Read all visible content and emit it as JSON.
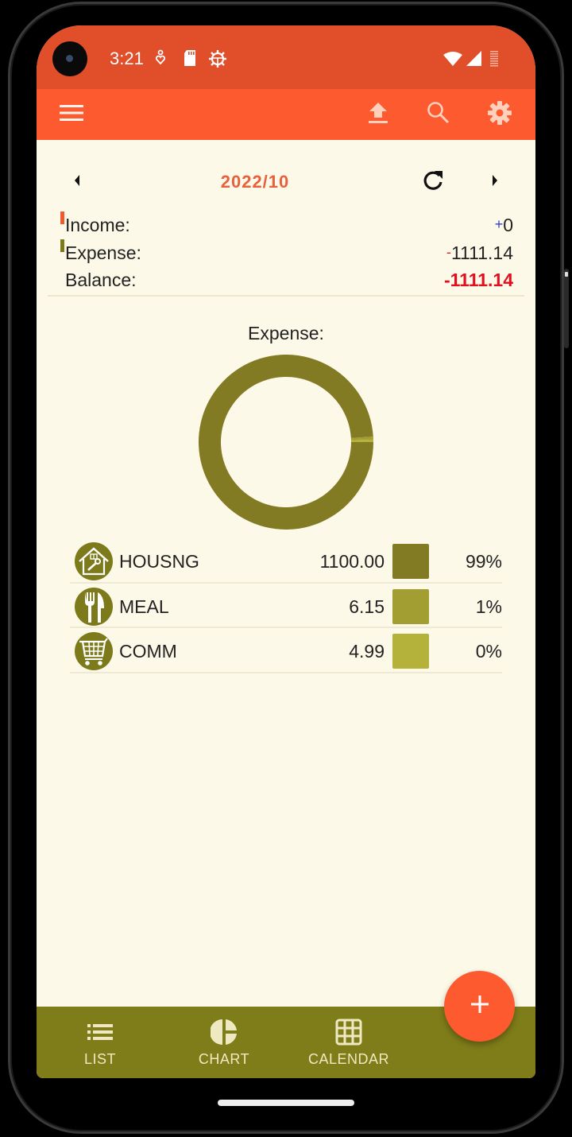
{
  "status_bar": {
    "time": "3:21",
    "left_icons": [
      "location-heart-icon",
      "sd-card-icon",
      "debug-bug-icon"
    ],
    "right_icons": [
      "wifi-icon",
      "cell-signal-icon",
      "battery-icon"
    ]
  },
  "toolbar": {
    "menu_icon": "hamburger-menu-icon",
    "actions": [
      "upload-icon",
      "search-icon",
      "settings-gear-icon"
    ]
  },
  "month_nav": {
    "label": "2022/10",
    "prev_icon": "caret-left-icon",
    "refresh_icon": "refresh-icon",
    "next_icon": "caret-right-icon"
  },
  "summary": {
    "income": {
      "label": "Income:",
      "sign": "+",
      "value": "0",
      "marker_color": "#f05a2e",
      "sign_color": "#2a3fd6"
    },
    "expense": {
      "label": "Expense:",
      "sign": "-",
      "value": "1111.14",
      "marker_color": "#7d7a1c",
      "sign_color": "#e0262a"
    },
    "balance": {
      "label": "Balance:",
      "sign": "-",
      "value": "1111.14",
      "color": "#e0101f"
    }
  },
  "chart_data": {
    "type": "pie",
    "title": "Expense:",
    "categories": [
      "HOUSNG",
      "MEAL",
      "COMM"
    ],
    "values": [
      1100.0,
      6.15,
      4.99
    ],
    "colors": [
      "#837a24",
      "#a39e32",
      "#b5b23c"
    ],
    "percent_labels": [
      "99%",
      "1%",
      "0%"
    ],
    "amount_labels": [
      "1100.00",
      "6.15",
      "4.99"
    ],
    "donut": true,
    "legend": "bottom"
  },
  "legend_rows": [
    {
      "icon": "house-repair-icon",
      "name": "HOUSNG",
      "amount": "1100.00",
      "pct": "99%",
      "color": "#837a24"
    },
    {
      "icon": "fork-knife-icon",
      "name": "MEAL",
      "amount": "6.15",
      "pct": "1%",
      "color": "#a39e32"
    },
    {
      "icon": "shopping-cart-icon",
      "name": "COMM",
      "amount": "4.99",
      "pct": "0%",
      "color": "#b5b23c"
    }
  ],
  "bottom_nav": {
    "items": [
      {
        "label": "LIST",
        "icon": "list-icon"
      },
      {
        "label": "CHART",
        "icon": "pie-chart-icon"
      },
      {
        "label": "CALENDAR",
        "icon": "calendar-grid-icon"
      }
    ]
  },
  "fab": {
    "icon": "plus-icon"
  },
  "colors": {
    "status_bar": "#e14e2a",
    "toolbar": "#fd5a30",
    "background": "#fdf9e8",
    "bottom_nav": "#7f7d19",
    "accent_month": "#e8603c"
  }
}
